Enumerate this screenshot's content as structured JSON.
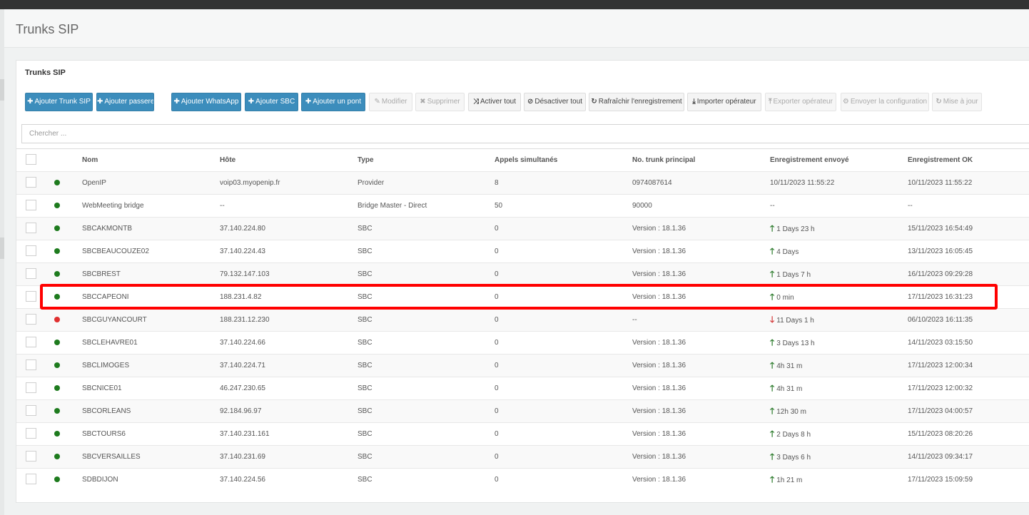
{
  "page_title": "Trunks SIP",
  "panel": {
    "title": "Trunks SIP",
    "search_placeholder": "Chercher ..."
  },
  "toolbar": [
    {
      "label": "Ajouter Trunk SIP",
      "icon": "plus-icon",
      "style": "primary"
    },
    {
      "label": "Ajouter passerelle",
      "icon": "plus-icon",
      "style": "primary"
    },
    {
      "label": "Ajouter WhatsApp",
      "icon": "plus-icon",
      "style": "primary"
    },
    {
      "label": "Ajouter SBC",
      "icon": "plus-icon",
      "style": "primary"
    },
    {
      "label": "Ajouter un pont",
      "icon": "plus-icon",
      "style": "primary"
    },
    {
      "label": "Modifier",
      "icon": "pencil-icon",
      "style": "disabled"
    },
    {
      "label": "Supprimer",
      "icon": "cross-icon",
      "style": "disabled"
    },
    {
      "label": "Activer tout",
      "icon": "shuffle-icon",
      "style": "default"
    },
    {
      "label": "Désactiver tout",
      "icon": "ban-icon",
      "style": "default"
    },
    {
      "label": "Rafraîchir l'enregistrement",
      "icon": "refresh-icon",
      "style": "default"
    },
    {
      "label": "Importer opérateur",
      "icon": "download-icon",
      "style": "default"
    },
    {
      "label": "Exporter opérateur",
      "icon": "upload-icon",
      "style": "disabled"
    },
    {
      "label": "Envoyer la configuration",
      "icon": "gear-icon",
      "style": "disabled"
    },
    {
      "label": "Mise à jour",
      "icon": "refresh-icon",
      "style": "disabled"
    }
  ],
  "colors": {
    "primary": "#3c8dbc",
    "status_ok": "#1e7b1e",
    "status_error": "#e03030",
    "highlight": "#ff0000"
  },
  "table": {
    "columns": [
      "Nom",
      "Hôte",
      "Type",
      "Appels simultanés",
      "No. trunk principal",
      "Enregistrement envoyé",
      "Enregistrement OK"
    ],
    "rows": [
      {
        "status": "ok",
        "name": "OpenIP",
        "host": "voip03.myopenip.fr",
        "type": "Provider",
        "calls": "8",
        "trunk": "0974087614",
        "sent": "10/11/2023 11:55:22",
        "sent_arrow": "",
        "ok": "10/11/2023 11:55:22"
      },
      {
        "status": "ok",
        "name": "WebMeeting bridge",
        "host": "--",
        "type": "Bridge Master - Direct",
        "calls": "50",
        "trunk": "90000",
        "sent": "--",
        "sent_arrow": "",
        "ok": "--"
      },
      {
        "status": "ok",
        "name": "SBCAKMONTB",
        "host": "37.140.224.80",
        "type": "SBC",
        "calls": "0",
        "trunk": "Version : 18.1.36",
        "sent": "1 Days 23 h",
        "sent_arrow": "up",
        "ok": "15/11/2023 16:54:49"
      },
      {
        "status": "ok",
        "name": "SBCBEAUCOUZE02",
        "host": "37.140.224.43",
        "type": "SBC",
        "calls": "0",
        "trunk": "Version : 18.1.36",
        "sent": "4 Days",
        "sent_arrow": "up",
        "ok": "13/11/2023 16:05:45"
      },
      {
        "status": "ok",
        "name": "SBCBREST",
        "host": "79.132.147.103",
        "type": "SBC",
        "calls": "0",
        "trunk": "Version : 18.1.36",
        "sent": "1 Days 7 h",
        "sent_arrow": "up",
        "ok": "16/11/2023 09:29:28"
      },
      {
        "status": "ok",
        "name": "SBCCAPEONI",
        "host": "188.231.4.82",
        "type": "SBC",
        "calls": "0",
        "trunk": "Version : 18.1.36",
        "sent": "0 min",
        "sent_arrow": "up",
        "ok": "17/11/2023 16:31:23"
      },
      {
        "status": "error",
        "name": "SBCGUYANCOURT",
        "host": "188.231.12.230",
        "type": "SBC",
        "calls": "0",
        "trunk": "--",
        "sent": "11 Days 1 h",
        "sent_arrow": "down",
        "ok": "06/10/2023 16:11:35"
      },
      {
        "status": "ok",
        "name": "SBCLEHAVRE01",
        "host": "37.140.224.66",
        "type": "SBC",
        "calls": "0",
        "trunk": "Version : 18.1.36",
        "sent": "3 Days 13 h",
        "sent_arrow": "up",
        "ok": "14/11/2023 03:15:50"
      },
      {
        "status": "ok",
        "name": "SBCLIMOGES",
        "host": "37.140.224.71",
        "type": "SBC",
        "calls": "0",
        "trunk": "Version : 18.1.36",
        "sent": "4h 31 m",
        "sent_arrow": "up",
        "ok": "17/11/2023 12:00:34"
      },
      {
        "status": "ok",
        "name": "SBCNICE01",
        "host": "46.247.230.65",
        "type": "SBC",
        "calls": "0",
        "trunk": "Version : 18.1.36",
        "sent": "4h 31 m",
        "sent_arrow": "up",
        "ok": "17/11/2023 12:00:32"
      },
      {
        "status": "ok",
        "name": "SBCORLEANS",
        "host": "92.184.96.97",
        "type": "SBC",
        "calls": "0",
        "trunk": "Version : 18.1.36",
        "sent": "12h 30 m",
        "sent_arrow": "up",
        "ok": "17/11/2023 04:00:57"
      },
      {
        "status": "ok",
        "name": "SBCTOURS6",
        "host": "37.140.231.161",
        "type": "SBC",
        "calls": "0",
        "trunk": "Version : 18.1.36",
        "sent": "2 Days 8 h",
        "sent_arrow": "up",
        "ok": "15/11/2023 08:20:26"
      },
      {
        "status": "ok",
        "name": "SBCVERSAILLES",
        "host": "37.140.231.69",
        "type": "SBC",
        "calls": "0",
        "trunk": "Version : 18.1.36",
        "sent": "3 Days 6 h",
        "sent_arrow": "up",
        "ok": "14/11/2023 09:34:17"
      },
      {
        "status": "ok",
        "name": "SDBDIJON",
        "host": "37.140.224.56",
        "type": "SBC",
        "calls": "0",
        "trunk": "Version : 18.1.36",
        "sent": "1h 21 m",
        "sent_arrow": "up",
        "ok": "17/11/2023 15:09:59"
      }
    ],
    "highlighted_row": "SBCCAPEONI"
  }
}
